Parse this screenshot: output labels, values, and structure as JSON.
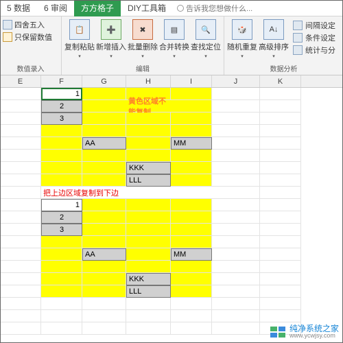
{
  "tabs": {
    "t0": "5 数据",
    "t1": "6 审阅",
    "t2": "方方格子",
    "t3": "DIY工具箱",
    "tellme": "告诉我您想做什么..."
  },
  "ribbon": {
    "group1_label": "数值录入",
    "g1_sishe": "四舍五入",
    "g1_baoliu": "只保留数值",
    "group2_label": "编辑",
    "g2_copy": "复制粘贴",
    "g2_insert": "新增插入",
    "g2_batchdel": "批量删除",
    "g2_merge": "合并转换",
    "g2_find": "查找定位",
    "group3_label": "数据分析",
    "g3_rand": "随机重复",
    "g3_sort": "高级排序",
    "g3_interval": "间隔设定",
    "g3_cond": "条件设定",
    "g3_stat": "统计与分"
  },
  "cols": {
    "E": "E",
    "F": "F",
    "G": "G",
    "H": "H",
    "I": "I",
    "J": "J",
    "K": "K"
  },
  "cells": {
    "f1": "1",
    "f2": "2",
    "f3": "3",
    "warn": "黄色区域不能复制",
    "g_aa": "AA",
    "i_mm": "MM",
    "h_kkk": "KKK",
    "h_lll": "LLL",
    "instr": "把上边区域复制到下边",
    "f1b": "1",
    "f2b": "2",
    "f3b": "3",
    "g_aa2": "AA",
    "i_mm2": "MM",
    "h_kkk2": "KKK",
    "h_lll2": "LLL"
  },
  "watermark": {
    "name": "纯净系统之家",
    "url": "www.ycwjsy.com"
  }
}
